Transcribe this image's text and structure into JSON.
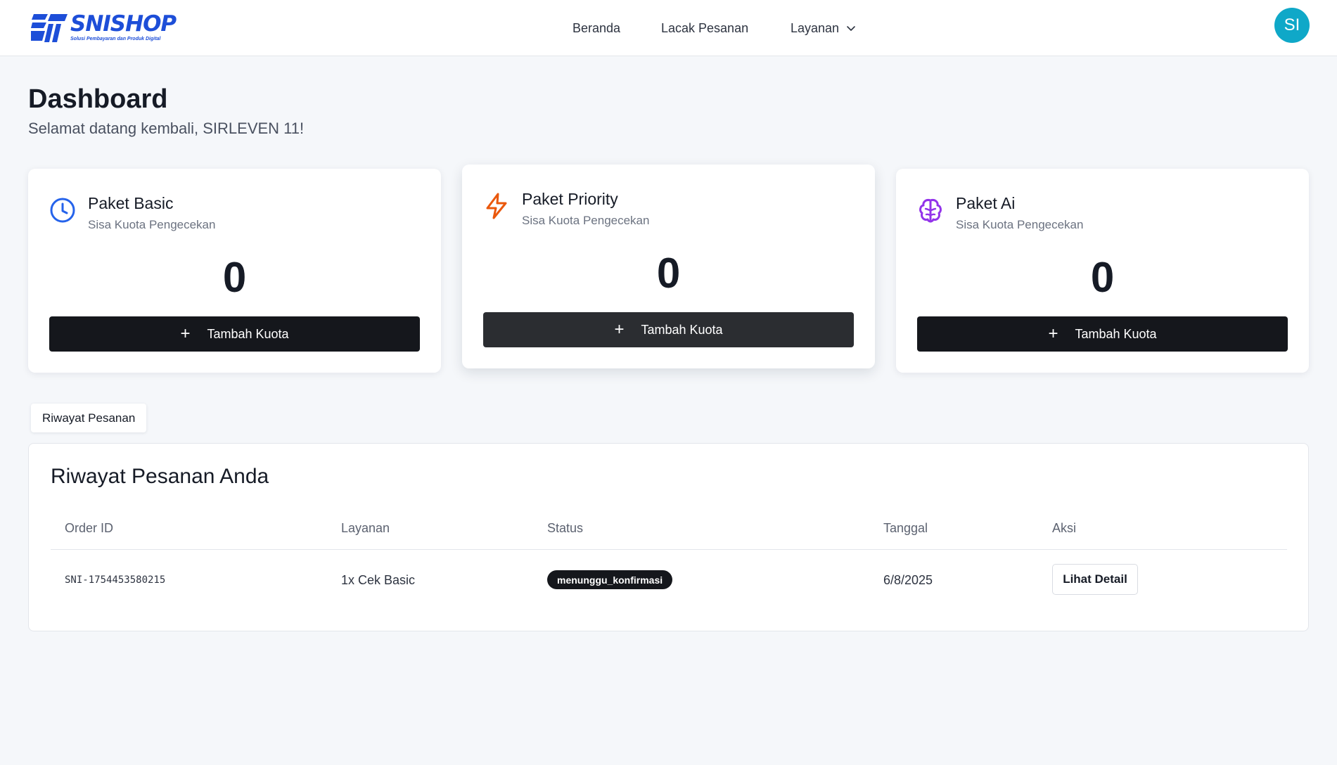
{
  "header": {
    "logo": {
      "word": "SNISHOP",
      "tagline": "Solusi Pembayaran dan Produk Digital"
    },
    "nav": [
      {
        "label": "Beranda"
      },
      {
        "label": "Lacak Pesanan"
      },
      {
        "label": "Layanan",
        "icon": "chevron-down-icon"
      }
    ],
    "avatar_initials": "SI",
    "avatar_color": "#0fa8c8"
  },
  "dashboard": {
    "title": "Dashboard",
    "subtitle": "Selamat datang kembali, SIRLEVEN 11!"
  },
  "cards": [
    {
      "title": "Paket Basic",
      "subtitle": "Sisa Kuota Pengecekan",
      "count": "0",
      "button_icon": "+",
      "button_label": "Tambah Kuota",
      "icon": "clock-icon",
      "icon_color": "#2563eb"
    },
    {
      "title": "Paket Priority",
      "subtitle": "Sisa Kuota Pengecekan",
      "count": "0",
      "button_icon": "+",
      "button_label": "Tambah Kuota",
      "icon": "lightning-icon",
      "icon_color": "#ea580c"
    },
    {
      "title": "Paket Ai",
      "subtitle": "Sisa Kuota Pengecekan",
      "count": "0",
      "button_icon": "+",
      "button_label": "Tambah Kuota",
      "icon": "brain-icon",
      "icon_color": "#9333ea"
    }
  ],
  "tabs": [
    {
      "label": "Riwayat Pesanan"
    }
  ],
  "orders": {
    "title": "Riwayat Pesanan Anda",
    "columns": [
      "Order ID",
      "Layanan",
      "Status",
      "Tanggal",
      "Aksi"
    ],
    "rows": [
      {
        "order_id": "SNI-1754453580215",
        "service": "1x Cek Basic",
        "status": "menunggu_konfirmasi",
        "date": "6/8/2025",
        "action": "Lihat Detail"
      }
    ]
  }
}
